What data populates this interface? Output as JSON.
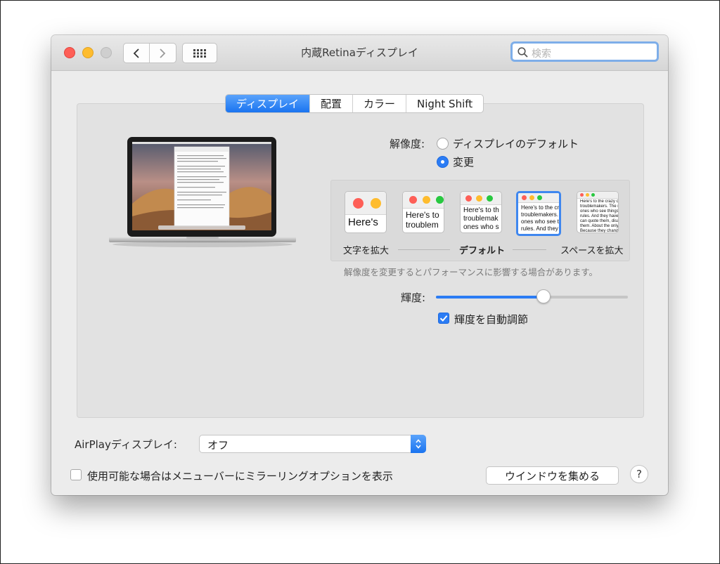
{
  "window": {
    "title": "内蔵Retinaディスプレイ",
    "search_placeholder": "検索"
  },
  "tabs": [
    {
      "label": "ディスプレイ",
      "active": true
    },
    {
      "label": "配置",
      "active": false
    },
    {
      "label": "カラー",
      "active": false
    },
    {
      "label": "Night Shift",
      "active": false
    }
  ],
  "resolution": {
    "label": "解像度:",
    "options": [
      {
        "label": "ディスプレイのデフォルト",
        "selected": false
      },
      {
        "label": "変更",
        "selected": true
      }
    ],
    "thumbnails": [
      {
        "text": "Here's",
        "selected": false
      },
      {
        "text": "Here's to\ntroublem",
        "selected": false
      },
      {
        "text": "Here's to th\ntroublemak\nones who s",
        "selected": false
      },
      {
        "text": "Here's to the cr\ntroublemakers.\nones who see t\nrules. And they",
        "selected": true
      },
      {
        "text": "Here's to the crazy ones\ntroublemakers. The rou\nones who see things di\nrules. And they have no\ncan quote them, disagr\nthem. About the only th\nBecause they change t",
        "selected": false
      }
    ],
    "scale_left": "文字を拡大",
    "scale_middle": "デフォルト",
    "scale_right": "スペースを拡大",
    "note": "解像度を変更するとパフォーマンスに影響する場合があります。"
  },
  "brightness": {
    "label": "輝度:",
    "level": 0.56,
    "auto_label": "輝度を自動調節",
    "auto_checked": true
  },
  "airplay": {
    "label": "AirPlayディスプレイ:",
    "value": "オフ"
  },
  "mirroring": {
    "label": "使用可能な場合はメニューバーにミラーリングオプションを表示",
    "checked": false
  },
  "gather_button": "ウインドウを集める",
  "help_label": "?",
  "colors": {
    "accent": "#2b7cf4",
    "close": "#fe5f57",
    "minimize": "#febc2e",
    "zoom_disabled": "#cfcfcf"
  }
}
